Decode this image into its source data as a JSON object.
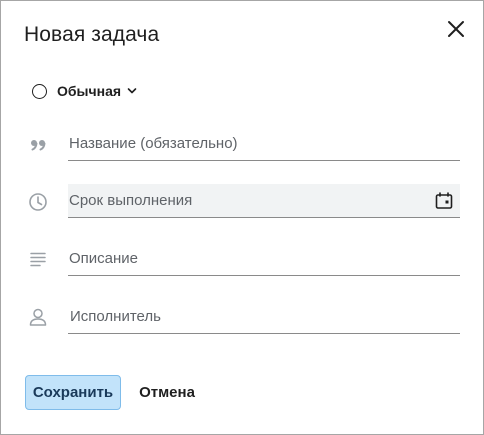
{
  "dialog": {
    "title": "Новая задача"
  },
  "priority": {
    "label": "Обычная"
  },
  "fields": {
    "name_placeholder": "Название (обязательно)",
    "due_placeholder": "Срок выполнения",
    "description_placeholder": "Описание",
    "assignee_placeholder": "Исполнитель"
  },
  "buttons": {
    "save": "Сохранить",
    "cancel": "Отмена"
  },
  "icons": {
    "close": "close-icon",
    "priority": "circle-outline-icon",
    "priority_dropdown": "chevron-down-icon",
    "name": "quote-icon",
    "due": "clock-icon",
    "calendar": "calendar-icon",
    "description": "notes-icon",
    "assignee": "person-icon"
  },
  "colors": {
    "save_bg": "#c2e3fa",
    "save_border": "#7fbcea",
    "date_field_bg": "#f1f3f4",
    "icon_gray": "#9aa0a6"
  }
}
